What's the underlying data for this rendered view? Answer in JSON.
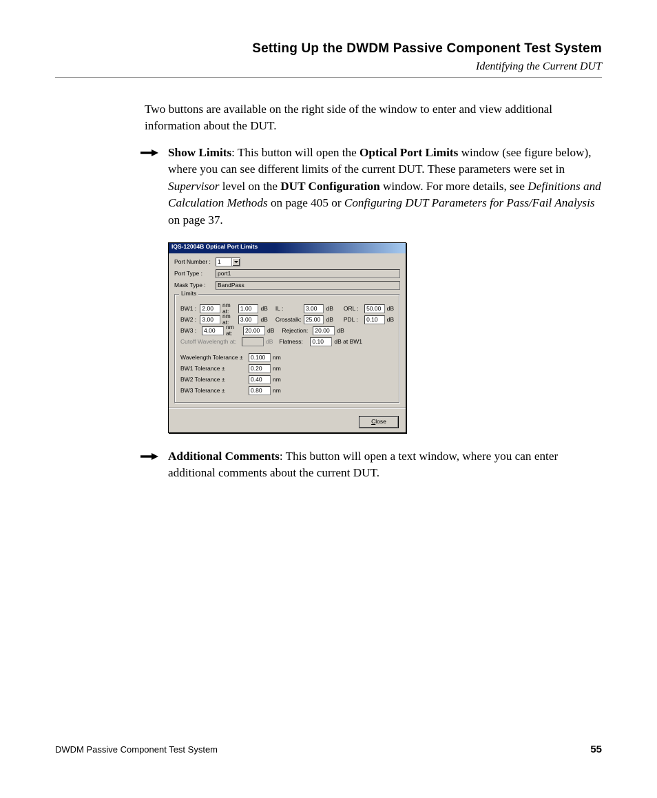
{
  "header": {
    "title": "Setting Up the DWDM Passive Component Test System",
    "subtitle": "Identifying the Current DUT"
  },
  "intro": "Two buttons are available on the right side of the window to enter and view additional information about the DUT.",
  "bullets": {
    "show_limits": {
      "label": "Show Limits",
      "text1": ": This button will open the ",
      "bold1": "Optical Port Limits",
      "text2": " window (see figure below), where you can see different limits of the current DUT. These parameters were set in ",
      "ital1": "Supervisor",
      "text3": " level on the ",
      "bold2": "DUT Configuration",
      "text4": " window. For more details, see ",
      "ital2": "Definitions and Calculation Methods",
      "text5": " on page 405 or ",
      "ital3": "Configuring DUT Parameters for Pass/Fail Analysis",
      "text6": " on page 37."
    },
    "additional": {
      "label": "Additional Comments",
      "text": ": This button will open a text window, where you can enter additional comments about the current DUT."
    }
  },
  "dialog": {
    "title": "IQS-12004B Optical Port Limits",
    "port_number_label": "Port Number :",
    "port_number_value": "1",
    "port_type_label": "Port Type :",
    "port_type_value": "port1",
    "mask_type_label": "Mask Type :",
    "mask_type_value": "BandPass",
    "limits_legend": "Limits",
    "bw1": {
      "label": "BW1 :",
      "nm": "2.00",
      "at_label": "nm at:",
      "db": "1.00",
      "unit": "dB"
    },
    "bw2": {
      "label": "BW2 :",
      "nm": "3.00",
      "at_label": "nm at:",
      "db": "3.00",
      "unit": "dB"
    },
    "bw3": {
      "label": "BW3 :",
      "nm": "4.00",
      "at_label": "nm at:",
      "db": "20.00",
      "unit": "dB"
    },
    "cutoff": {
      "label": "Cutoff Wavelength at:",
      "value": "",
      "unit": "dB"
    },
    "il": {
      "label": "IL :",
      "value": "3.00",
      "unit": "dB"
    },
    "xtalk": {
      "label": "Crosstalk:",
      "value": "25.00",
      "unit": "dB"
    },
    "rej": {
      "label": "Rejection:",
      "value": "20.00",
      "unit": "dB"
    },
    "flat": {
      "label": "Flatness:",
      "value": "0.10",
      "unit": "dB at BW1"
    },
    "orl": {
      "label": "ORL :",
      "value": "50.00",
      "unit": "dB"
    },
    "pdl": {
      "label": "PDL :",
      "value": "0.10",
      "unit": "dB"
    },
    "wltol": {
      "label": "Wavelength Tolerance ±",
      "value": "0.100",
      "unit": "nm"
    },
    "bw1tol": {
      "label": "BW1 Tolerance ±",
      "value": "0.20",
      "unit": "nm"
    },
    "bw2tol": {
      "label": "BW2 Tolerance ±",
      "value": "0.40",
      "unit": "nm"
    },
    "bw3tol": {
      "label": "BW3 Tolerance ±",
      "value": "0.80",
      "unit": "nm"
    },
    "close_prefix": "C",
    "close_rest": "lose"
  },
  "footer": {
    "product": "DWDM Passive Component Test System",
    "page": "55"
  }
}
